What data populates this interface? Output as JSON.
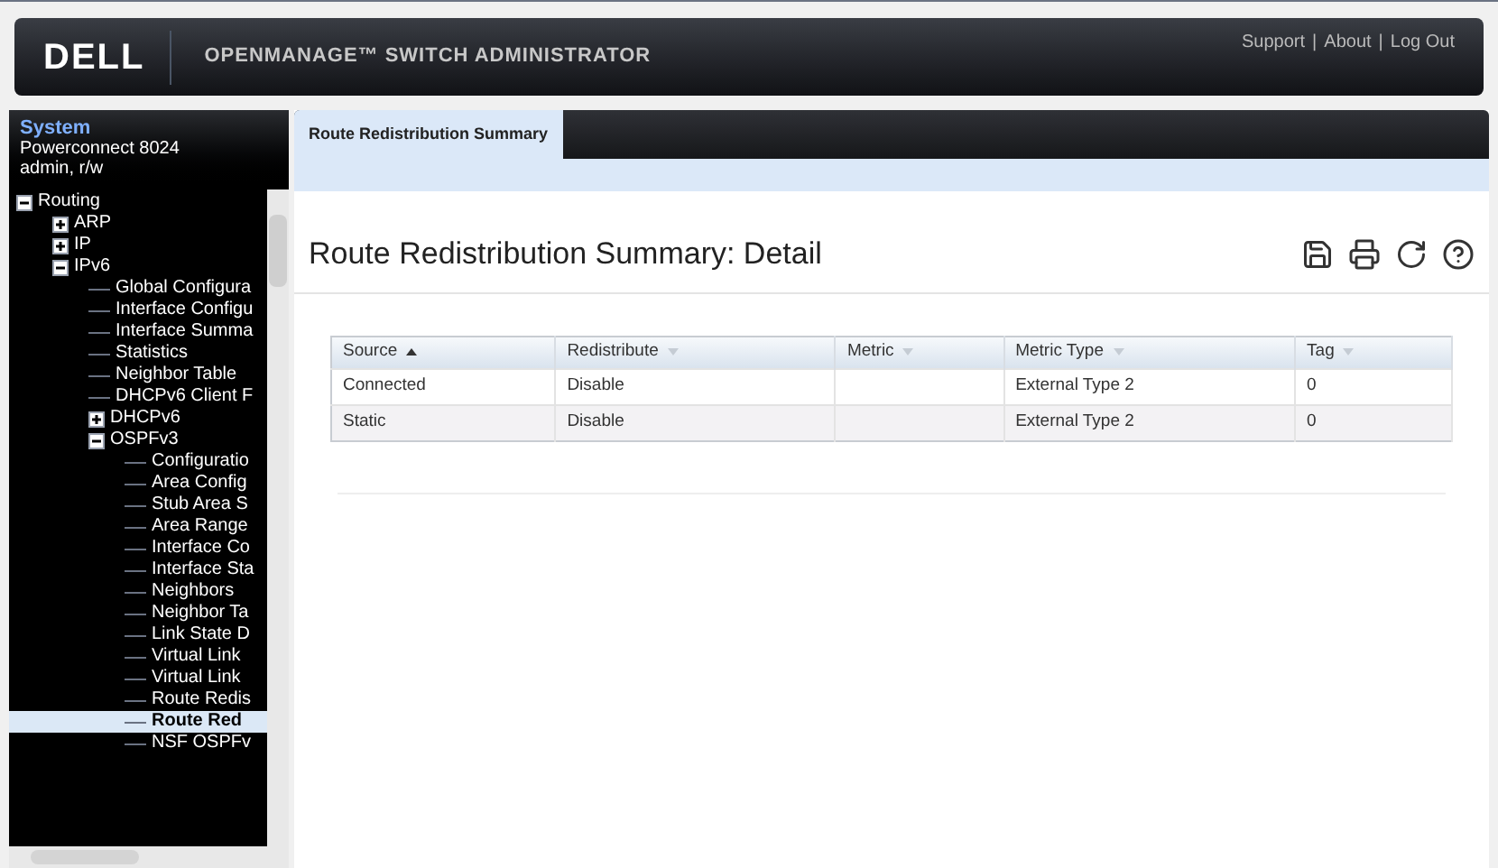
{
  "header": {
    "logo": "DELL",
    "title": "OPENMANAGE™ SWITCH ADMINISTRATOR",
    "links": [
      "Support",
      "About",
      "Log Out"
    ],
    "separator": "|"
  },
  "sidebar": {
    "title": "System",
    "device": "Powerconnect 8024",
    "user": "admin, r/w",
    "tree": [
      {
        "label": "Routing",
        "expanded": true,
        "selected": false,
        "children": [
          {
            "label": "ARP",
            "expanded": false,
            "selected": false
          },
          {
            "label": "IP",
            "expanded": false,
            "selected": false
          },
          {
            "label": "IPv6",
            "expanded": true,
            "selected": false,
            "children": [
              {
                "label": "Global Configura",
                "selected": false
              },
              {
                "label": "Interface Configu",
                "selected": false
              },
              {
                "label": "Interface Summa",
                "selected": false
              },
              {
                "label": "Statistics",
                "selected": false
              },
              {
                "label": "Neighbor Table",
                "selected": false
              },
              {
                "label": "DHCPv6 Client F",
                "selected": false
              },
              {
                "label": "DHCPv6",
                "expanded": false,
                "selected": false
              },
              {
                "label": "OSPFv3",
                "expanded": true,
                "selected": false,
                "children": [
                  {
                    "label": "Configuratio",
                    "selected": false
                  },
                  {
                    "label": "Area Config",
                    "selected": false
                  },
                  {
                    "label": "Stub Area S",
                    "selected": false
                  },
                  {
                    "label": "Area Range",
                    "selected": false
                  },
                  {
                    "label": "Interface Co",
                    "selected": false
                  },
                  {
                    "label": "Interface Sta",
                    "selected": false
                  },
                  {
                    "label": "Neighbors",
                    "selected": false
                  },
                  {
                    "label": "Neighbor Ta",
                    "selected": false
                  },
                  {
                    "label": "Link State D",
                    "selected": false
                  },
                  {
                    "label": "Virtual Link",
                    "selected": false
                  },
                  {
                    "label": "Virtual Link",
                    "selected": false
                  },
                  {
                    "label": "Route Redis",
                    "selected": false
                  },
                  {
                    "label": "Route Red",
                    "selected": true
                  },
                  {
                    "label": "NSF OSPFv",
                    "selected": false
                  }
                ]
              }
            ]
          }
        ]
      }
    ]
  },
  "tabs": [
    {
      "label": "Route Redistribution Summary",
      "selected": true
    }
  ],
  "page": {
    "title": "Route Redistribution Summary: Detail"
  },
  "table": {
    "columns": [
      {
        "label": "Source",
        "sorted": true
      },
      {
        "label": "Redistribute",
        "sorted": false
      },
      {
        "label": "Metric",
        "sorted": false
      },
      {
        "label": "Metric Type",
        "sorted": false
      },
      {
        "label": "Tag",
        "sorted": false
      }
    ],
    "rows": [
      [
        "Connected",
        "Disable",
        "",
        "External Type 2",
        "0"
      ],
      [
        "Static",
        "Disable",
        "",
        "External Type 2",
        "0"
      ]
    ]
  }
}
